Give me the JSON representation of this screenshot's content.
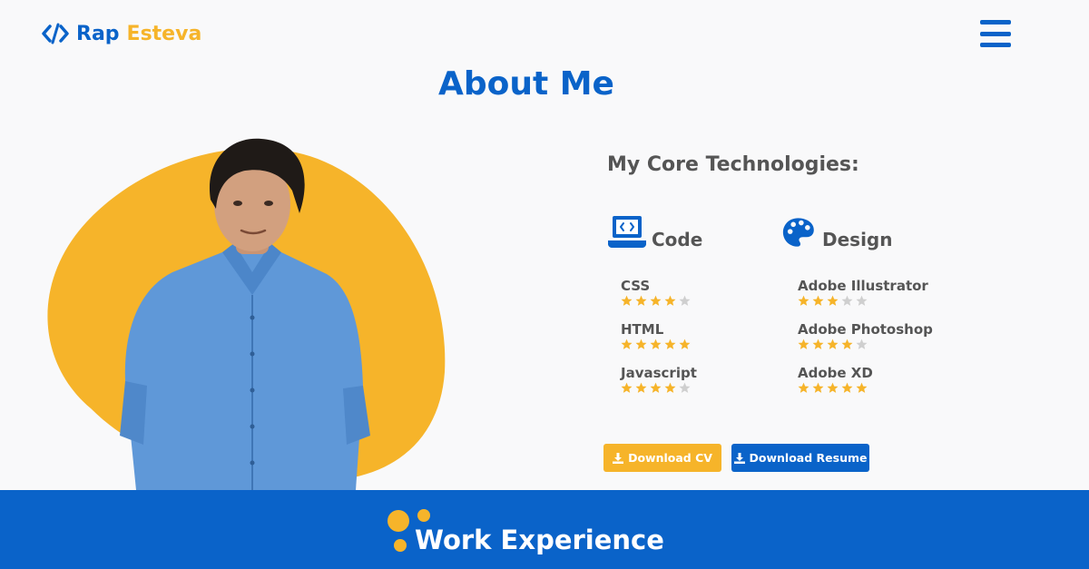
{
  "header": {
    "logo_first": "Rap",
    "logo_last": "Esteva"
  },
  "about": {
    "title": "About Me",
    "tech_heading": "My Core Technologies:"
  },
  "categories": {
    "code": "Code",
    "design": "Design"
  },
  "skills": {
    "code": [
      {
        "name": "CSS",
        "rating": 4
      },
      {
        "name": "HTML",
        "rating": 5
      },
      {
        "name": "Javascript",
        "rating": 4
      }
    ],
    "design": [
      {
        "name": "Adobe Illustrator",
        "rating": 3
      },
      {
        "name": "Adobe Photoshop",
        "rating": 4
      },
      {
        "name": "Adobe XD",
        "rating": 5
      }
    ],
    "max_rating": 5
  },
  "buttons": {
    "download_cv": "Download CV",
    "download_resume": "Download Resume"
  },
  "next_section": {
    "title": "Work Experience"
  },
  "colors": {
    "primary": "#0a63c9",
    "accent": "#f6b42a",
    "star_empty": "#cfcfcf"
  }
}
